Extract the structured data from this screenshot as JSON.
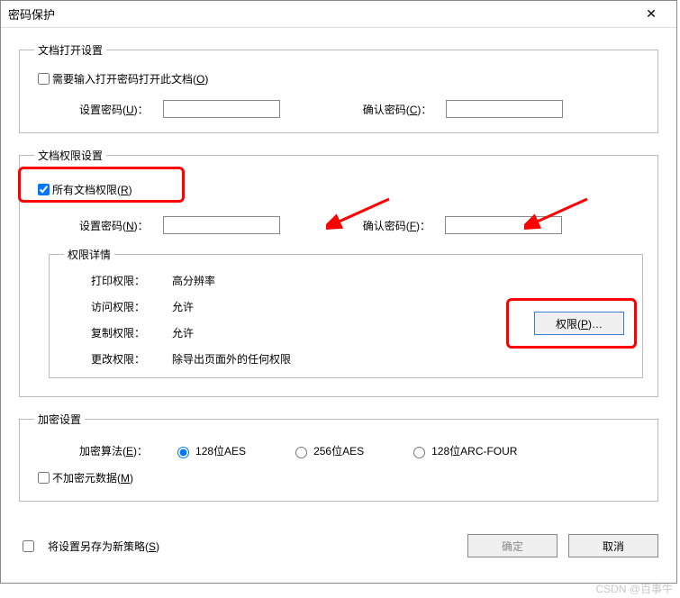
{
  "title": "密码保护",
  "open_section": {
    "legend": "文档打开设置",
    "require_password_label": "需要输入打开密码打开此文档(",
    "require_password_key": "O",
    "set_pw_label": "设置密码(",
    "set_pw_key": "U",
    "confirm_pw_label": "确认密码(",
    "confirm_pw_key": "C",
    "set_pw_value": "",
    "confirm_pw_value": ""
  },
  "perm_section": {
    "legend": "文档权限设置",
    "all_perm_label": "所有文档权限(",
    "all_perm_key": "R",
    "set_pw_label": "设置密码(",
    "set_pw_key": "N",
    "confirm_pw_label": "确认密码(",
    "confirm_pw_key": "F",
    "set_pw_value": "",
    "confirm_pw_value": "",
    "detail_legend": "权限详情",
    "print_label": "打印权限：",
    "print_value": "高分辨率",
    "access_label": "访问权限：",
    "access_value": "允许",
    "copy_label": "复制权限：",
    "copy_value": "允许",
    "change_label": "更改权限：",
    "change_value": "除导出页面外的任何权限",
    "perm_btn_label": "权限(",
    "perm_btn_key": "P",
    "perm_btn_suffix": ")…"
  },
  "enc_section": {
    "legend": "加密设置",
    "algo_label": "加密算法(",
    "algo_key": "E",
    "opt1": "128位AES",
    "opt2": "256位AES",
    "opt3": "128位ARC-FOUR",
    "no_meta_label": "不加密元数据(",
    "no_meta_key": "M"
  },
  "bottom": {
    "save_strategy_label": "将设置另存为新策略(",
    "save_strategy_key": "S",
    "ok": "确定",
    "cancel": "取消"
  },
  "close_paren": ")",
  "colon": "：",
  "watermark": "CSDN @百事牛"
}
